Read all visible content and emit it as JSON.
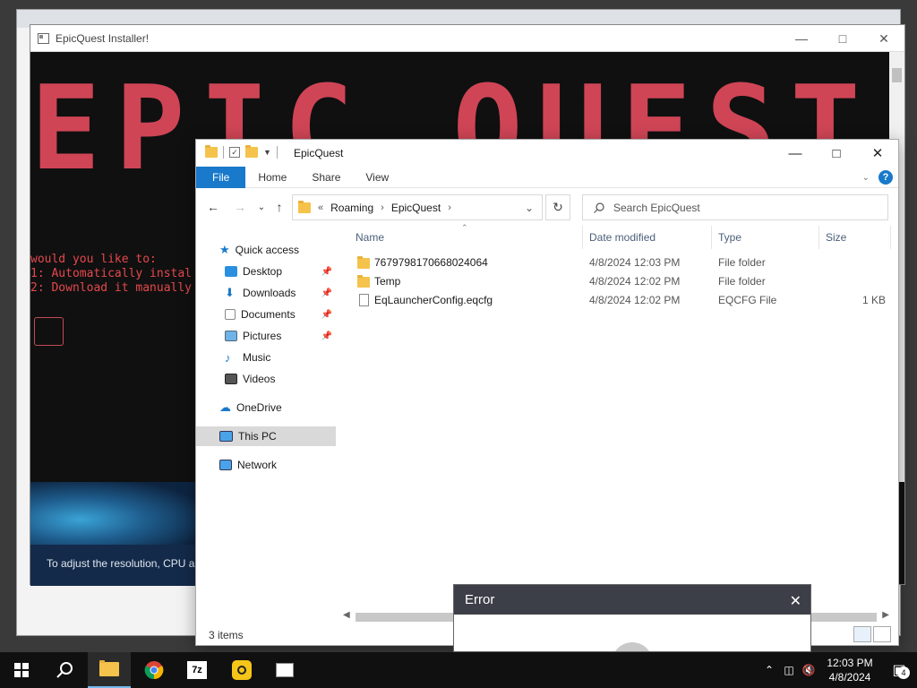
{
  "installer": {
    "title": "EpicQuest Installer!",
    "banner": "EPIC QUEST",
    "console_lines": "would you like to:\n1: Automatically instal\n2: Download it manually",
    "adjust_text": "To adjust the resolution, CPU a"
  },
  "explorer": {
    "title": "EpicQuest",
    "ribbon": {
      "file": "File",
      "home": "Home",
      "share": "Share",
      "view": "View"
    },
    "address": {
      "overflow": "«",
      "crumbs": [
        "Roaming",
        "EpicQuest"
      ]
    },
    "search_placeholder": "Search EpicQuest",
    "nav": {
      "quick_access": "Quick access",
      "desktop": "Desktop",
      "downloads": "Downloads",
      "documents": "Documents",
      "pictures": "Pictures",
      "music": "Music",
      "videos": "Videos",
      "onedrive": "OneDrive",
      "this_pc": "This PC",
      "network": "Network"
    },
    "columns": {
      "name": "Name",
      "date": "Date modified",
      "type": "Type",
      "size": "Size"
    },
    "files": [
      {
        "name": "7679798170668024064",
        "date": "4/8/2024 12:03 PM",
        "type": "File folder",
        "size": ""
      },
      {
        "name": "Temp",
        "date": "4/8/2024 12:02 PM",
        "type": "File folder",
        "size": ""
      },
      {
        "name": "EqLauncherConfig.eqcfg",
        "date": "4/8/2024 12:02 PM",
        "type": "EQCFG File",
        "size": "1 KB"
      }
    ],
    "status": "3 items"
  },
  "error_dialog": {
    "title": "Error"
  },
  "taskbar": {
    "time": "12:03 PM",
    "date": "4/8/2024",
    "notification_count": "4"
  },
  "colors": {
    "accent": "#1979ca",
    "banner_red": "#e04a5c",
    "folder": "#f5c34b",
    "taskbar": "#101010"
  }
}
